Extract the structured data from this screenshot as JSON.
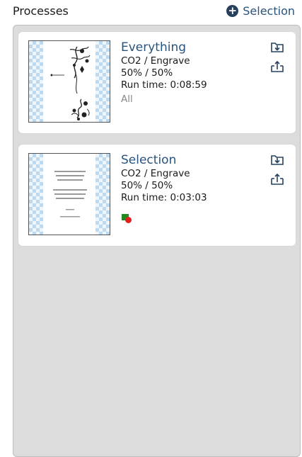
{
  "header": {
    "title": "Processes",
    "add_label": "Selection"
  },
  "processes": [
    {
      "name": "Everything",
      "laser": "CO2 / Engrave",
      "power_speed": "50% / 50%",
      "run_time": "Run time: 0:08:59",
      "scope": "All"
    },
    {
      "name": "Selection",
      "laser": "CO2 / Engrave",
      "power_speed": "50% / 50%",
      "run_time": "Run time: 0:03:03",
      "scope": ""
    }
  ]
}
